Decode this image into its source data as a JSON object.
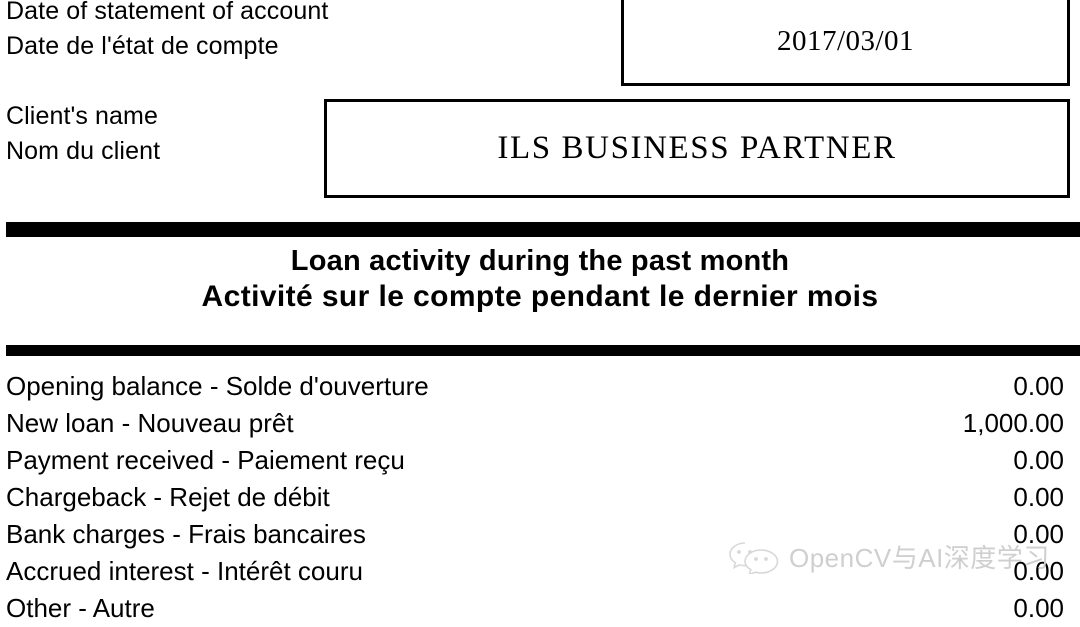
{
  "header": {
    "date_label_en": "Date of statement of account",
    "date_label_fr": "Date de l'état de compte",
    "date_value": "2017/03/01",
    "client_label_en": "Client's name",
    "client_label_fr": "Nom du client",
    "client_value": "ILS BUSINESS PARTNER"
  },
  "section": {
    "title_en": "Loan activity during the past month",
    "title_fr": "Activité sur le compte pendant le dernier mois"
  },
  "items": [
    {
      "label": "Opening balance - Solde d'ouverture",
      "amount": "0.00"
    },
    {
      "label": "New loan - Nouveau prêt",
      "amount": "1,000.00"
    },
    {
      "label": "Payment received - Paiement reçu",
      "amount": "0.00"
    },
    {
      "label": "Chargeback - Rejet de débit",
      "amount": "0.00"
    },
    {
      "label": "Bank charges - Frais bancaires",
      "amount": "0.00"
    },
    {
      "label": "Accrued interest - Intérêt couru",
      "amount": "0.00"
    },
    {
      "label": "Other - Autre",
      "amount": "0.00"
    }
  ],
  "watermark": {
    "text": "OpenCV与AI深度学习",
    "color": "#cfcfcf"
  },
  "colors": {
    "ink": "#000000",
    "page": "#ffffff",
    "rule": "#000000"
  }
}
